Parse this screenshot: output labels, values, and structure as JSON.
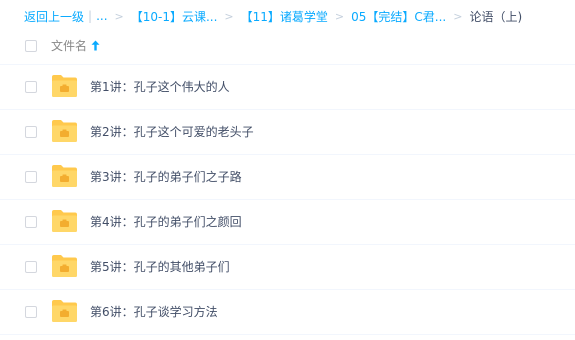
{
  "breadcrumb": {
    "back": "返回上一级",
    "ellipsis": "...",
    "items": [
      "【10-1】云课...",
      "【11】诸葛学堂",
      "05【完结】C君...",
      "论语（上)"
    ]
  },
  "header": {
    "column_label": "文件名"
  },
  "files": [
    "第1讲：孔子这个伟大的人",
    "第2讲：孔子这个可爱的老头子",
    "第3讲：孔子的弟子们之子路",
    "第4讲：孔子的弟子们之颜回",
    "第5讲：孔子的其他弟子们",
    "第6讲：孔子谈学习方法"
  ],
  "colors": {
    "link": "#09aaff",
    "text": "#424e67",
    "folder": "#ffc94d"
  },
  "icons": {
    "folder": "folder-icon",
    "sort": "sort-ascending-arrow-icon",
    "checkbox": "checkbox-icon"
  }
}
